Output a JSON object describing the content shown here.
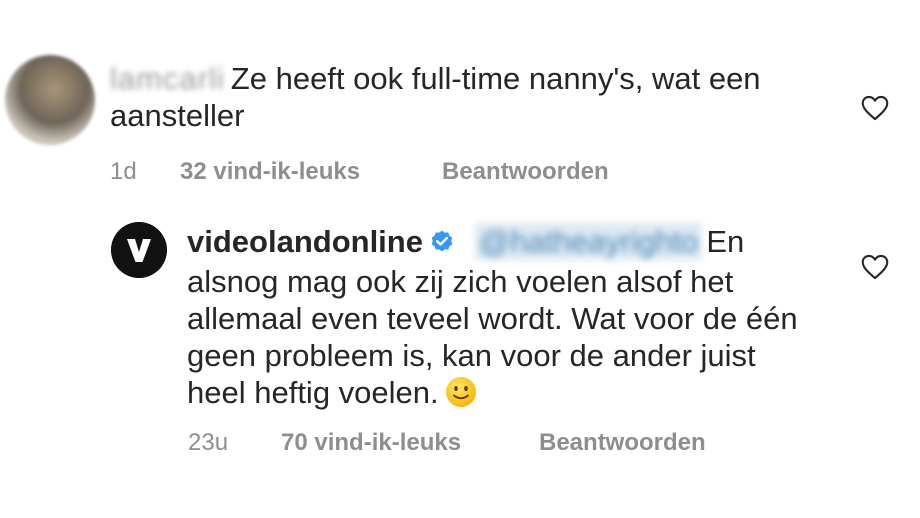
{
  "comments": [
    {
      "username": "lamcarli",
      "text": "Ze heeft ook full-time nanny's, wat een aansteller",
      "time": "1d",
      "likes": "32 vind-ik-leuks",
      "reply_label": "Beantwoorden",
      "like_icon": "heart-icon"
    },
    {
      "username": "videolandonline",
      "verified": true,
      "mention": "@hatheayrighto",
      "text": "En alsnog mag ook zij zich voelen alsof het allemaal even teveel wordt. Wat voor de één geen probleem is, kan voor de ander juist heel heftig voelen.",
      "emoji": "slightly-smiling-face",
      "time": "23u",
      "likes": "70 vind-ik-leuks",
      "reply_label": "Beantwoorden",
      "like_icon": "heart-icon"
    }
  ],
  "colors": {
    "text": "#262626",
    "meta": "#8e8e8e",
    "verified": "#3897f0",
    "mention": "#00376b"
  }
}
